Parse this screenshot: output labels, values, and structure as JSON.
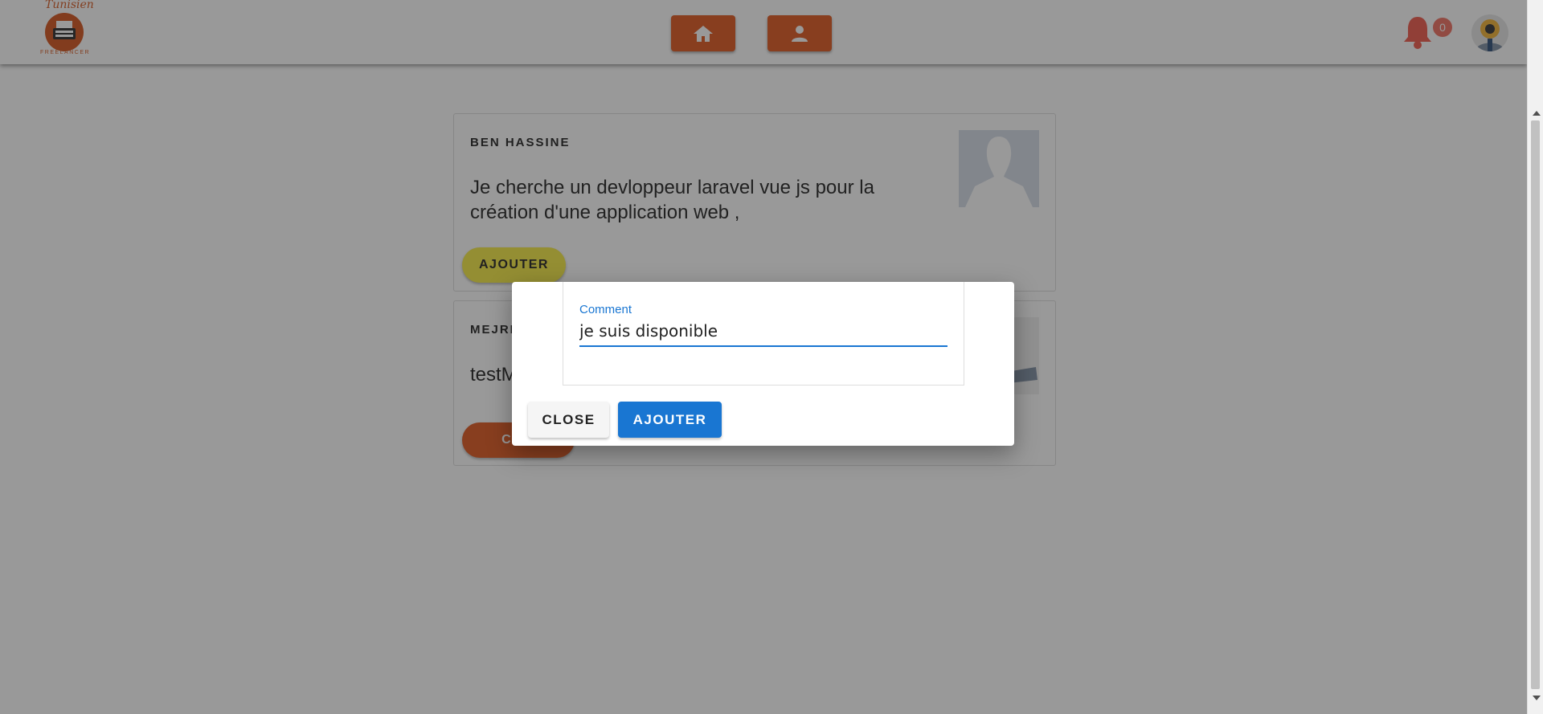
{
  "header": {
    "logo": {
      "script_text": "Tunisien",
      "caption": "FREELANCER",
      "icon": "typewriter-logo-icon"
    },
    "nav": [
      {
        "icon": "home-icon"
      },
      {
        "icon": "user-icon"
      }
    ],
    "notifications": {
      "icon": "bell-icon",
      "count": "0"
    },
    "avatar": {
      "icon": "user-avatar-icon"
    }
  },
  "posts": [
    {
      "author": "BEN HASSINE",
      "body": "Je cherche un devloppeur laravel vue js pour la création d'une application web ,",
      "action": "AJOUTER"
    },
    {
      "author": "MEJRI",
      "body": "testM",
      "action": "COM"
    }
  ],
  "dialog": {
    "field_label": "Comment",
    "field_value": "je suis disponible",
    "close_label": "CLOSE",
    "submit_label": "AJOUTER"
  },
  "colors": {
    "brand_orange": "#e0571e",
    "accent_yellow": "#f6ea44",
    "primary_blue": "#1976d2",
    "badge_red": "#f07060"
  }
}
